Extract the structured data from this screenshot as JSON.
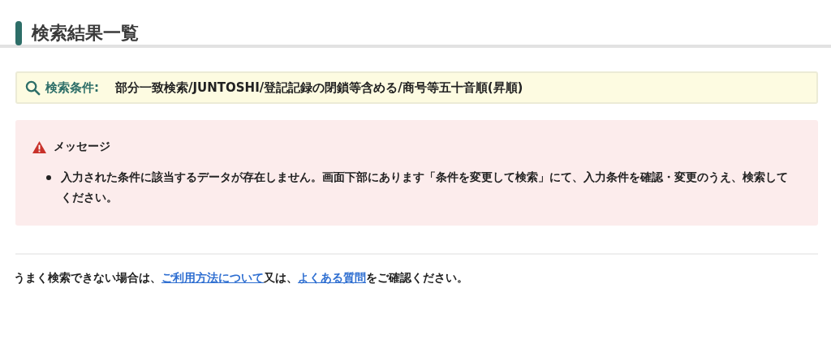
{
  "page_title": "検索結果一覧",
  "search_conditions": {
    "label": "検索条件:",
    "value": "部分一致検索/JUNTOSHI/登記記録の閉鎖等含める/商号等五十音順(昇順)"
  },
  "message": {
    "title": "メッセージ",
    "items": [
      "入力された条件に該当するデータが存在しません。画面下部にあります「条件を変更して検索」にて、入力条件を確認・変更のうえ、検索してください。"
    ]
  },
  "help": {
    "parts": [
      {
        "kind": "text",
        "text": "うまく検索できない場合は、"
      },
      {
        "kind": "link",
        "text": "ご利用方法について"
      },
      {
        "kind": "text",
        "text": "又は、"
      },
      {
        "kind": "link",
        "text": "よくある質問"
      },
      {
        "kind": "text",
        "text": "をご確認ください。"
      }
    ]
  }
}
